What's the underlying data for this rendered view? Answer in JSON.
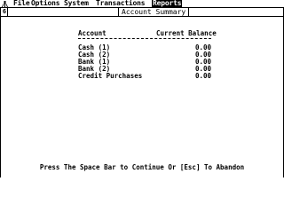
{
  "menubar": {
    "icon": "atari-fuji-icon",
    "items": [
      {
        "label": "File"
      },
      {
        "label": "Options"
      },
      {
        "label": "System"
      },
      {
        "label": "Transactions"
      },
      {
        "label": "Reports",
        "active": true
      }
    ]
  },
  "window": {
    "title": "Account Summary",
    "close_glyph": "6"
  },
  "report": {
    "header_account": "Account",
    "header_balance": "Current Balance",
    "rows": [
      {
        "account": "Cash (1)",
        "balance": "0.00"
      },
      {
        "account": "Cash (2)",
        "balance": "0.00"
      },
      {
        "account": "Bank (1)",
        "balance": "0.00"
      },
      {
        "account": "Bank (2)",
        "balance": "0.00"
      },
      {
        "account": "Credit Purchases",
        "balance": "0.00"
      }
    ]
  },
  "footer": {
    "prompt": "Press The Space Bar to Continue Or [Esc] To Abandon"
  }
}
